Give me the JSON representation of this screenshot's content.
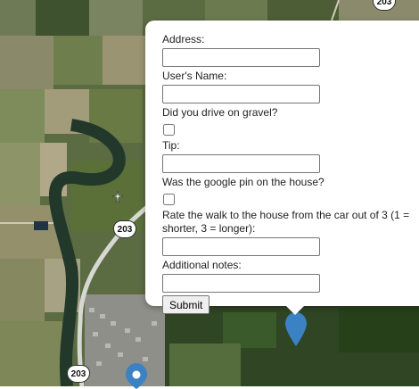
{
  "map": {
    "route_shields": [
      "203",
      "203",
      "203"
    ]
  },
  "popup": {
    "address_label": "Address:",
    "address_value": "",
    "name_label": "User's Name:",
    "name_value": "",
    "gravel_label": "Did you drive on gravel?",
    "gravel_checked": false,
    "tip_label": "Tip:",
    "tip_value": "",
    "pin_label": "Was the google pin on the house?",
    "pin_checked": false,
    "walk_label": "Rate the walk to the house from the car out of 3 (1 = shorter, 3 = longer):",
    "walk_value": "",
    "notes_label": "Additional notes:",
    "notes_value": "",
    "submit_label": "Submit"
  },
  "markers": {
    "active_color": "#3b82c4",
    "active_icon": "map-pin-icon",
    "selected_icon": "location-dot-icon"
  }
}
